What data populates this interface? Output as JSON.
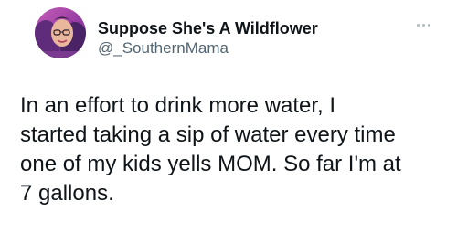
{
  "tweet": {
    "author": {
      "display_name": "Suppose She's A Wildflower",
      "handle": "@_SouthernMama"
    },
    "text": "In an effort to drink more water, I\nstarted taking a sip of water every time\none of my kids yells MOM. So far I'm at\n7 gallons.",
    "more_icon": "more-horizontal-icon"
  },
  "colors": {
    "text": "#0f1419",
    "secondary_text": "#536471",
    "more_icon": "#b0b8bf",
    "background": "#ffffff"
  }
}
